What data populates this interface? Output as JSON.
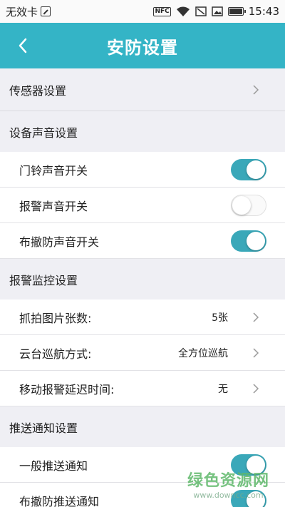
{
  "status_bar": {
    "carrier": "无效卡",
    "nfc": "NFC",
    "time": "15:43"
  },
  "header": {
    "title": "安防设置"
  },
  "sections": {
    "sensor": {
      "label": "传感器设置"
    },
    "sound": {
      "label": "设备声音设置",
      "items": [
        {
          "label": "门铃声音开关",
          "on": true
        },
        {
          "label": "报警声音开关",
          "on": false
        },
        {
          "label": "布撤防声音开关",
          "on": true
        }
      ]
    },
    "monitor": {
      "label": "报警监控设置",
      "items": [
        {
          "label": "抓拍图片张数:",
          "value": "5张"
        },
        {
          "label": "云台巡航方式:",
          "value": "全方位巡航"
        },
        {
          "label": "移动报警延迟时间:",
          "value": "无"
        }
      ]
    },
    "push": {
      "label": "推送通知设置",
      "items": [
        {
          "label": "一般推送通知",
          "on": true
        },
        {
          "label": "布撤防推送通知",
          "on": true
        }
      ]
    }
  },
  "watermark": {
    "text": "绿色资源网",
    "url": "www.downcc.com"
  },
  "colors": {
    "accent": "#34b4c6",
    "toggle_on": "#3aa8b9",
    "background": "#efeff4"
  }
}
